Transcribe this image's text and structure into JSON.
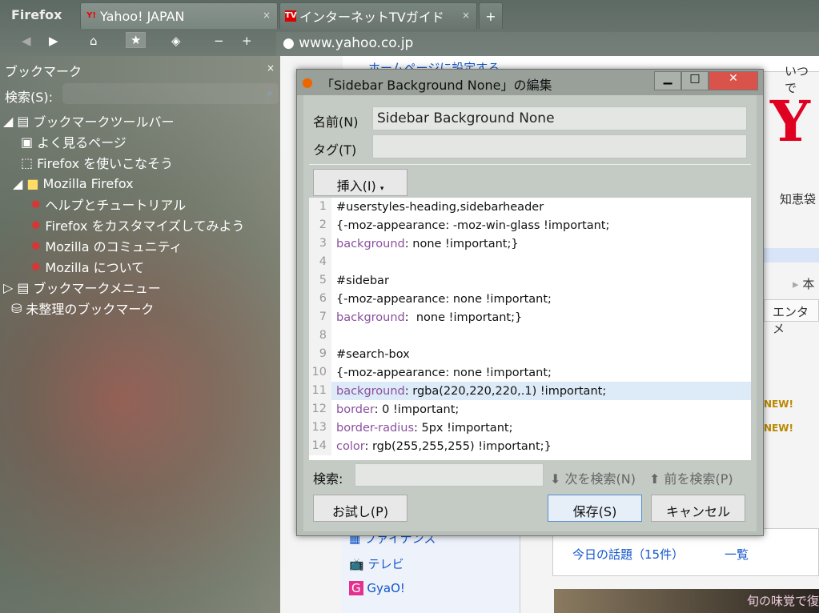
{
  "app": {
    "name": "Firefox"
  },
  "tabs": [
    {
      "label": "Yahoo! JAPAN",
      "icon": "Y!"
    },
    {
      "label": "インターネットTVガイド",
      "icon": "TV"
    }
  ],
  "new_tab": "+",
  "url": "www.yahoo.co.jp",
  "sidebar": {
    "title": "ブックマーク",
    "search_label": "検索(S):",
    "items": [
      {
        "label": "ブックマークツールバー"
      },
      {
        "label": "よく見るページ"
      },
      {
        "label": "Firefox を使いこなそう"
      },
      {
        "label": "Mozilla Firefox"
      },
      {
        "label": "ヘルプとチュートリアル"
      },
      {
        "label": "Firefox をカスタマイズしてみよう"
      },
      {
        "label": "Mozilla のコミュニティ"
      },
      {
        "label": "Mozilla について"
      },
      {
        "label": "ブックマークメニュー"
      },
      {
        "label": "未整理のブックマーク"
      }
    ]
  },
  "web": {
    "homepage": "ホームページに設定する",
    "always": "いつで",
    "chiebukuro": "知恵袋",
    "hon": "本",
    "entame": "エンタメ",
    "finance": "ファイナンス",
    "tv": "テレビ",
    "gyao": "GyaO!",
    "topics": "今日の話題（15件）",
    "list": "一覧",
    "new": "NEW!",
    "banner": "旬の味覚で復"
  },
  "dialog": {
    "title": "「Sidebar Background None」の編集",
    "name_label": "名前(N)",
    "name_value": "Sidebar Background None",
    "tag_label": "タグ(T)",
    "tag_value": "",
    "insert": "挿入(I)",
    "find_label": "検索:",
    "find_next": "次を検索(N)",
    "find_prev": "前を検索(P)",
    "preview": "お試し(P)",
    "save": "保存(S)",
    "cancel": "キャンセル",
    "code": [
      {
        "n": "1",
        "k": "",
        "t": "#userstyles-heading,sidebarheader"
      },
      {
        "n": "2",
        "k": "",
        "t": "{-moz-appearance: -moz-win-glass !important;"
      },
      {
        "n": "3",
        "k": "background",
        "t": ": none !important;}"
      },
      {
        "n": "4",
        "k": "",
        "t": ""
      },
      {
        "n": "5",
        "k": "",
        "t": "#sidebar"
      },
      {
        "n": "6",
        "k": "",
        "t": "{-moz-appearance: none !important;"
      },
      {
        "n": "7",
        "k": "background",
        "t": ":  none !important;}"
      },
      {
        "n": "8",
        "k": "",
        "t": ""
      },
      {
        "n": "9",
        "k": "",
        "t": "#search-box"
      },
      {
        "n": "10",
        "k": "",
        "t": "{-moz-appearance: none !important;"
      },
      {
        "n": "11",
        "k": "background",
        "t": ": rgba(220,220,220,.1) !important;"
      },
      {
        "n": "12",
        "k": "border",
        "t": ": 0 !important;"
      },
      {
        "n": "13",
        "k": "border-radius",
        "t": ": 5px !important;"
      },
      {
        "n": "14",
        "k": "color",
        "t": ": rgb(255,255,255) !important;}"
      }
    ]
  }
}
